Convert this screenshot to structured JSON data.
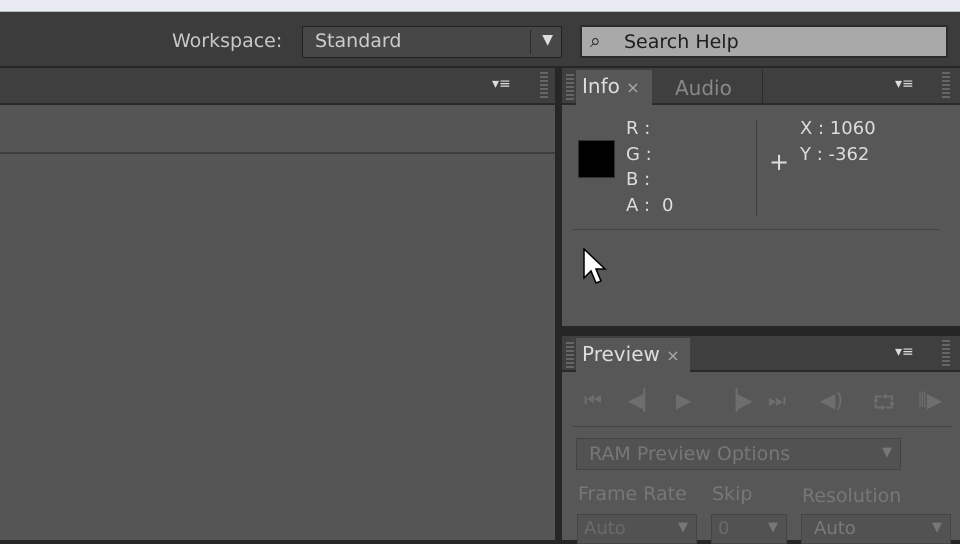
{
  "toolbar": {
    "workspace_label": "Workspace:",
    "workspace_value": "Standard",
    "search_placeholder": "Search Help"
  },
  "info": {
    "tabs": [
      "Info",
      "Audio"
    ],
    "r": "R :",
    "g": "G :",
    "b": "B :",
    "a": "A :",
    "a_value": "0",
    "x": "X : 1060",
    "y": "Y : -362",
    "swatch_color": "#000000"
  },
  "preview": {
    "tab": "Preview",
    "ram_options": "RAM Preview Options",
    "frame_rate_label": "Frame Rate",
    "skip_label": "Skip",
    "resolution_label": "Resolution",
    "frame_rate_value": "Auto",
    "skip_value": "0",
    "resolution_value": "Auto"
  },
  "icons": {
    "close": "×",
    "menu": "▾≡",
    "dropdown": "▼",
    "search": "⚲",
    "crosshair": "+"
  }
}
